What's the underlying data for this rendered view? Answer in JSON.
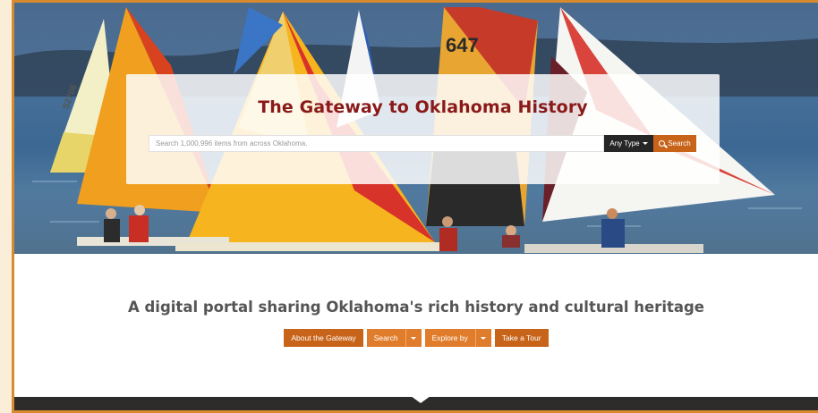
{
  "hero": {
    "title": "The Gateway to Oklahoma History",
    "search_placeholder": "Search 1,000,996 items from across Oklahoma.",
    "type_button_label": "Any Type",
    "search_button_label": "Search",
    "sail_numbers": [
      "647",
      "S2706"
    ]
  },
  "intro": {
    "tagline": "A digital portal sharing Oklahoma's rich history and cultural heritage"
  },
  "nav_buttons": {
    "about": "About the Gateway",
    "search": "Search",
    "explore": "Explore by",
    "tour": "Take a Tour"
  },
  "colors": {
    "accent": "#c8641a",
    "accent_light": "#e07d2c",
    "title_red": "#8a1a1a",
    "frame_border": "#d88b2e",
    "footer": "#2e2b2b"
  }
}
